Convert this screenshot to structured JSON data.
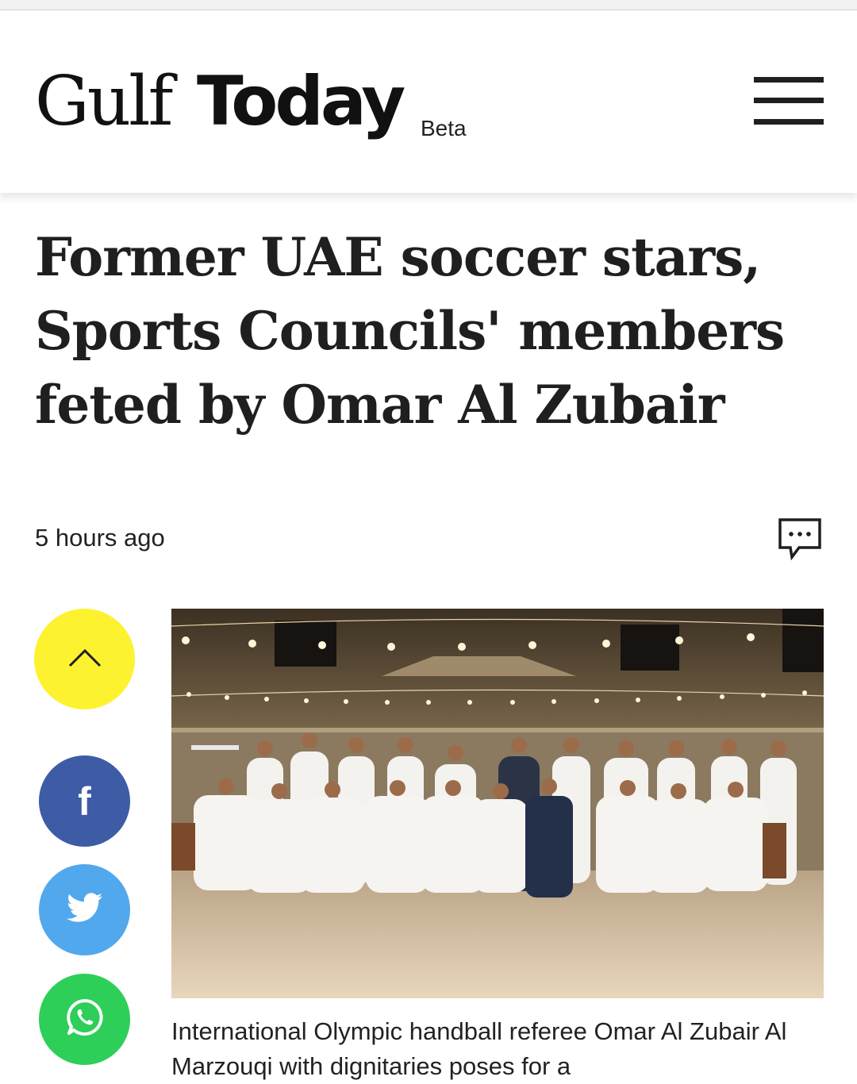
{
  "header": {
    "logo_part1": "Gulf",
    "logo_part2": "Today",
    "logo_badge": "Beta",
    "menu_icon": "hamburger-menu-icon"
  },
  "article": {
    "headline": "Former UAE soccer stars, Sports Councils' members feted by Omar Al Zubair",
    "timestamp": "5 hours ago",
    "comment_icon": "comment-bubble-icon",
    "image_caption": "International Olympic handball referee Omar Al Zubair Al Marzouqi with dignitaries poses for a"
  },
  "share_bar": {
    "scroll_top_icon": "chevron-up-icon",
    "facebook_glyph": "f",
    "twitter_icon": "twitter-bird-icon",
    "whatsapp_icon": "whatsapp-icon"
  },
  "colors": {
    "scroll_top": "#fdf22f",
    "facebook": "#3e5ba6",
    "twitter": "#51a8ec",
    "whatsapp": "#2dcf58",
    "text": "#1f1f1f"
  }
}
